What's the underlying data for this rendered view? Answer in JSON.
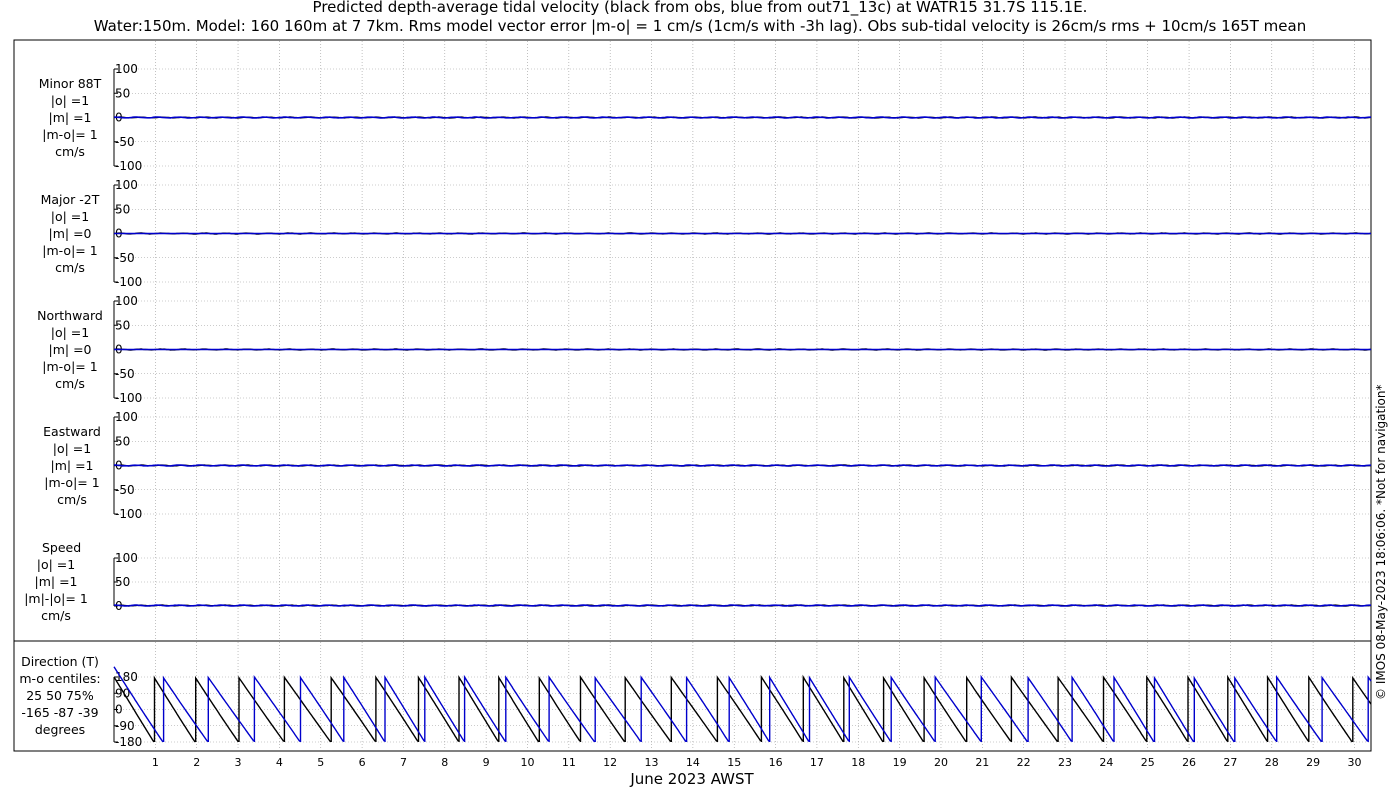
{
  "title_line1": "Predicted depth-average tidal velocity (black from obs, blue from out71_13c) at WATR15 31.7S 115.1E.",
  "title_line2": "Water:150m. Model: 160 160m at 7 7km. Rms model vector error |m-o| = 1 cm/s (1cm/s with -3h lag). Obs sub-tidal velocity is 26cm/s rms + 10cm/s 165T mean",
  "copyright": "© IMOS 08-May-2023 18:06:06.  *Not for navigation*",
  "xlabel": "June 2023 AWST",
  "colors": {
    "obs": "#000000",
    "model": "#0000cc",
    "grid": "#999999"
  },
  "chart_data": [
    {
      "type": "line",
      "panel": "minor",
      "label_lines": [
        "Minor 88T",
        "|o| =1",
        "|m| =1",
        "|m-o|= 1",
        "cm/s"
      ],
      "ylim": [
        -100,
        100
      ],
      "yticks": [
        100,
        50,
        0,
        -50,
        -100
      ],
      "series": [
        {
          "color": "obs",
          "level": 0,
          "amplitude": 1
        },
        {
          "color": "model",
          "level": 0,
          "amplitude": 1
        }
      ]
    },
    {
      "type": "line",
      "panel": "major",
      "label_lines": [
        "Major -2T",
        "|o| =1",
        "|m| =0",
        "|m-o|= 1",
        "cm/s"
      ],
      "ylim": [
        -100,
        100
      ],
      "yticks": [
        100,
        50,
        0,
        -50,
        -100
      ],
      "series": [
        {
          "color": "obs",
          "level": 0,
          "amplitude": 1
        },
        {
          "color": "model",
          "level": 0,
          "amplitude": 0
        }
      ]
    },
    {
      "type": "line",
      "panel": "northward",
      "label_lines": [
        "Northward",
        "|o| =1",
        "|m| =0",
        "|m-o|= 1",
        "cm/s"
      ],
      "ylim": [
        -100,
        100
      ],
      "yticks": [
        100,
        50,
        0,
        -50,
        -100
      ],
      "series": [
        {
          "color": "obs",
          "level": 0,
          "amplitude": 1
        },
        {
          "color": "model",
          "level": 0,
          "amplitude": 0
        }
      ]
    },
    {
      "type": "line",
      "panel": "eastward",
      "label_lines": [
        "Eastward",
        "|o| =1",
        "|m| =1",
        "|m-o|= 1",
        "cm/s"
      ],
      "ylim": [
        -100,
        100
      ],
      "yticks": [
        100,
        50,
        0,
        -50,
        -100
      ],
      "series": [
        {
          "color": "obs",
          "level": 0,
          "amplitude": 1
        },
        {
          "color": "model",
          "level": 0,
          "amplitude": 1
        }
      ]
    },
    {
      "type": "line",
      "panel": "speed",
      "label_lines": [
        "Speed",
        "|o| =1",
        "|m| =1",
        "|m|-|o|= 1",
        "cm/s"
      ],
      "ylim": [
        0,
        100
      ],
      "yticks": [
        100,
        50,
        0
      ],
      "series": [
        {
          "color": "obs",
          "level": 1,
          "amplitude": 1
        },
        {
          "color": "model",
          "level": 1,
          "amplitude": 1
        }
      ]
    },
    {
      "type": "line",
      "panel": "direction",
      "label_lines": [
        "Direction (T)",
        "m-o centiles:",
        "25  50  75%",
        "-165  -87  -39",
        "degrees"
      ],
      "ylim": [
        -180,
        180
      ],
      "yticks": [
        180,
        90,
        0,
        -90,
        -180
      ],
      "series": [
        {
          "color": "obs",
          "kind": "direction",
          "phase_deg": 0
        },
        {
          "color": "model",
          "kind": "direction",
          "phase_deg": -90
        }
      ]
    }
  ],
  "x_axis": {
    "range_days": [
      0,
      30.4
    ],
    "tick_labels": [
      "1",
      "2",
      "3",
      "4",
      "5",
      "6",
      "7",
      "8",
      "9",
      "10",
      "11",
      "12",
      "13",
      "14",
      "15",
      "16",
      "17",
      "18",
      "19",
      "20",
      "21",
      "22",
      "23",
      "24",
      "25",
      "26",
      "27",
      "28",
      "29",
      "30"
    ]
  }
}
